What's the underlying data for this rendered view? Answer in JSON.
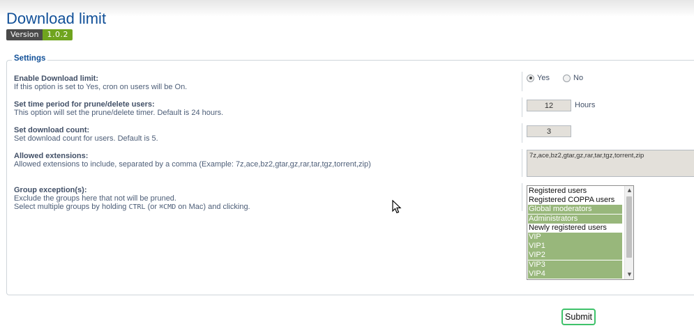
{
  "header": {
    "title": "Download limit",
    "version_label": "Version",
    "version_number": "1.0.2"
  },
  "settings": {
    "legend": "Settings",
    "enable": {
      "title": "Enable Download limit:",
      "desc": "If this option is set to Yes, cron on users will be On.",
      "yes_label": "Yes",
      "no_label": "No",
      "selected": "Yes"
    },
    "period": {
      "title": "Set time period for prune/delete users:",
      "desc": "This option will set the prune/delete timer. Default is 24 hours.",
      "value": "12",
      "unit": "Hours"
    },
    "count": {
      "title": "Set download count:",
      "desc": "Set download count for users. Default is 5.",
      "value": "3"
    },
    "extensions": {
      "title": "Allowed extensions:",
      "desc": "Allowed extensions to include, separated by a comma (Example: 7z,ace,bz2,gtar,gz,rar,tar,tgz,torrent,zip)",
      "value": "7z,ace,bz2,gtar,gz,rar,tar,tgz,torrent,zip"
    },
    "groups": {
      "title": "Group exception(s):",
      "desc1": "Exclude the groups here that not will be pruned.",
      "desc2_a": "Select multiple groups by holding ",
      "desc2_ctrl": "CTRL",
      "desc2_b": " (or ",
      "desc2_cmd": "⌘CMD",
      "desc2_c": " on Mac) and clicking.",
      "options": [
        {
          "label": "Registered users",
          "selected": false
        },
        {
          "label": "Registered COPPA users",
          "selected": false
        },
        {
          "label": "Global moderators",
          "selected": true
        },
        {
          "label": "Administrators",
          "selected": true
        },
        {
          "label": "Newly registered users",
          "selected": false
        },
        {
          "label": "VIP",
          "selected": true
        },
        {
          "label": "VIP1",
          "selected": true
        },
        {
          "label": "VIP2",
          "selected": true
        },
        {
          "label": "VIP3",
          "selected": true
        },
        {
          "label": "VIP4",
          "selected": true
        }
      ]
    }
  },
  "submit_label": "Submit",
  "colors": {
    "title": "#115098",
    "selected_option": "#98b77b",
    "submit_border": "#3ec26a",
    "input_bg": "#e3e0da"
  }
}
